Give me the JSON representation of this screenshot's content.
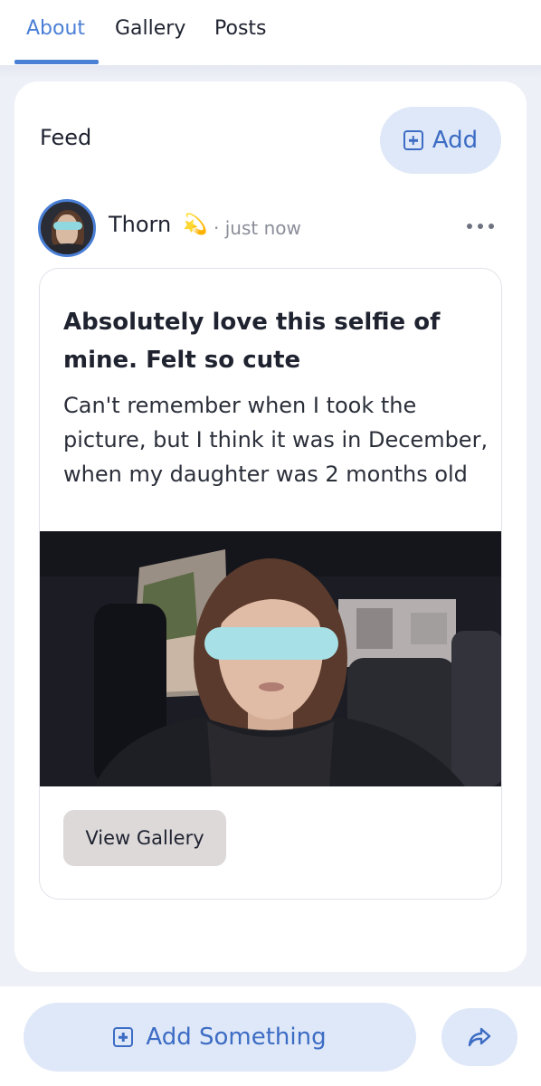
{
  "tabs": [
    {
      "label": "About",
      "active": true
    },
    {
      "label": "Gallery",
      "active": false
    },
    {
      "label": "Posts",
      "active": false
    }
  ],
  "feed": {
    "title": "Feed",
    "add_label": "Add"
  },
  "post": {
    "author": "Thorn",
    "author_emoji": "💫",
    "time": "· just now",
    "title": "Absolutely love this selfie of mine. Felt so cute",
    "body": "Can't remember when I took the picture, but I think it was in December, when my daughter was 2 months old",
    "gallery_button": "View Gallery"
  },
  "bottom_bar": {
    "add_label": "Add Something"
  },
  "colors": {
    "accent": "#4a7fd6",
    "button_bg": "#dfe8f8",
    "page_bg": "#eef0f7",
    "face_blur_bar": "#8fd8df"
  },
  "icons": {
    "add": "plus-square-icon",
    "more": "more-horizontal-icon",
    "share": "share-arrow-icon"
  }
}
